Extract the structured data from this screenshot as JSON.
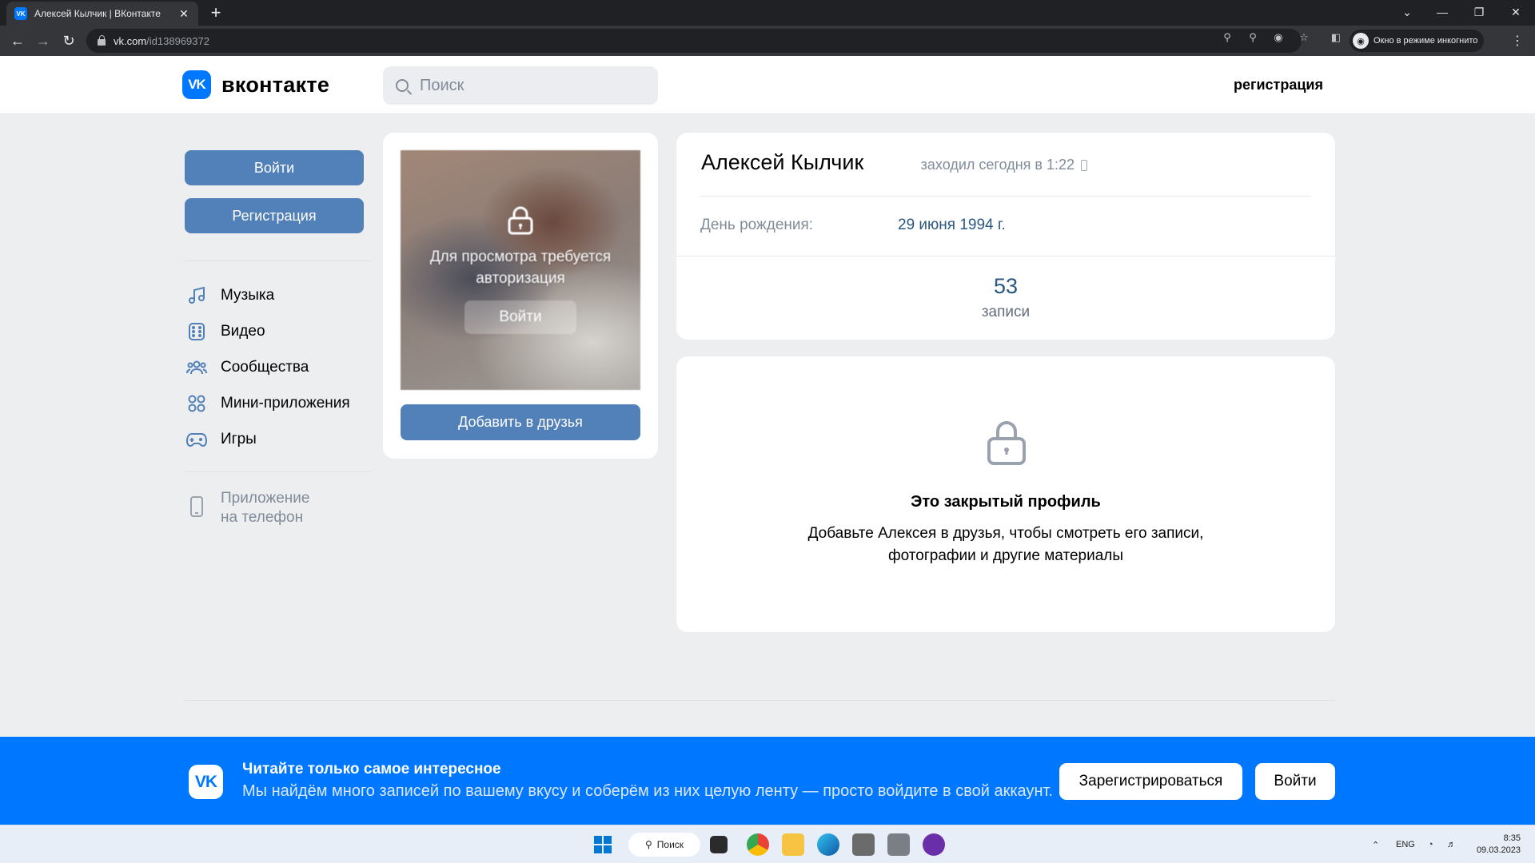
{
  "browser": {
    "tab_title": "Алексей Кылчик | ВКонтакте",
    "tab_close": "✕",
    "new_tab": "+",
    "url_host": "vk.com",
    "url_path": "/id138969372",
    "incognito_label": "Окно в режиме инкогнито",
    "window_controls": [
      "⌄",
      "—",
      "❐",
      "✕"
    ]
  },
  "header": {
    "logo_mark": "VK",
    "logo_text": "вконтакте",
    "search_placeholder": "Поиск",
    "register_link": "регистрация"
  },
  "sidebar": {
    "login_button": "Войти",
    "register_button": "Регистрация",
    "items": [
      {
        "label": "Музыка",
        "icon": "music-icon"
      },
      {
        "label": "Видео",
        "icon": "video-icon"
      },
      {
        "label": "Сообщества",
        "icon": "communities-icon"
      },
      {
        "label": "Мини-приложения",
        "icon": "mini-apps-icon"
      },
      {
        "label": "Игры",
        "icon": "games-icon"
      }
    ],
    "app_line1": "Приложение",
    "app_line2": "на телефон"
  },
  "photo_card": {
    "locked_text_line1": "Для просмотра требуется",
    "locked_text_line2": "авторизация",
    "login_button": "Войти",
    "add_friend_button": "Добавить в друзья"
  },
  "profile": {
    "name": "Алексей Кылчик",
    "last_seen": "заходил сегодня в 1:22",
    "birthday_label": "День рождения:",
    "birthday_value": "29 июня 1994 г.",
    "posts_count": "53",
    "posts_label": "записи"
  },
  "closed_profile": {
    "title": "Это закрытый профиль",
    "desc_line1": "Добавьте Алексея в друзья, чтобы смотреть его записи,",
    "desc_line2": "фотографии и другие материалы"
  },
  "banner": {
    "logo_mark": "VK",
    "title": "Читайте только самое интересное",
    "text": "Мы найдём много записей по вашему вкусу и соберём из них целую ленту — просто войдите в свой аккаунт.",
    "register_button": "Зарегистрироваться",
    "login_button": "Войти"
  },
  "taskbar": {
    "search_label": "Поиск",
    "lang": "ENG",
    "time": "8:35",
    "date": "09.03.2023"
  },
  "colors": {
    "vk_blue": "#0077ff",
    "button_blue": "#5181b8",
    "link_blue": "#2a5885",
    "page_bg": "#edeef0"
  }
}
